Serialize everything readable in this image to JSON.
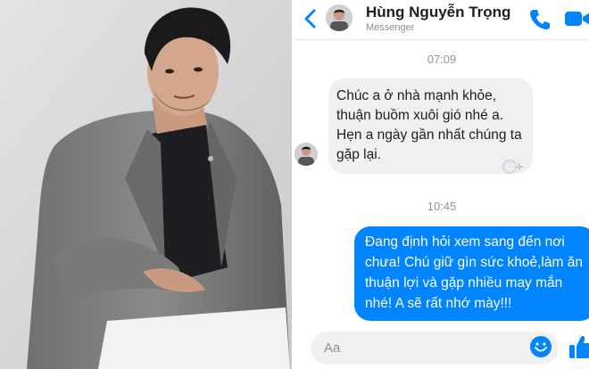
{
  "header": {
    "name": "Hùng Nguyễn Trọng",
    "subtitle": "Messenger"
  },
  "icons": {
    "back": "chevron-left-icon",
    "call": "phone-icon",
    "video": "video-camera-icon",
    "emoji": "emoji-icon",
    "like": "thumbs-up-icon",
    "reaction": "add-reaction-icon"
  },
  "messages": [
    {
      "time": "07:09",
      "from": "contact",
      "text": "Chúc a ở nhà mạnh khỏe, thuận buồm xuôi gió nhé a. Hẹn a ngày gần nhất chúng ta gặp lại."
    },
    {
      "time": "10:45",
      "from": "me",
      "text": "Đang định hỏi xem sang đến nơi chưa! Chú giữ gìn sức khoẻ,làm ăn thuận lợi và gặp nhiều may mắn nhé! A sẽ rất nhớ mày!!!"
    }
  ],
  "composer": {
    "placeholder": "Aa"
  },
  "colors": {
    "accent": "#0084ff",
    "incoming_bubble": "#f1f0f0",
    "outgoing_text": "#ffffff"
  }
}
